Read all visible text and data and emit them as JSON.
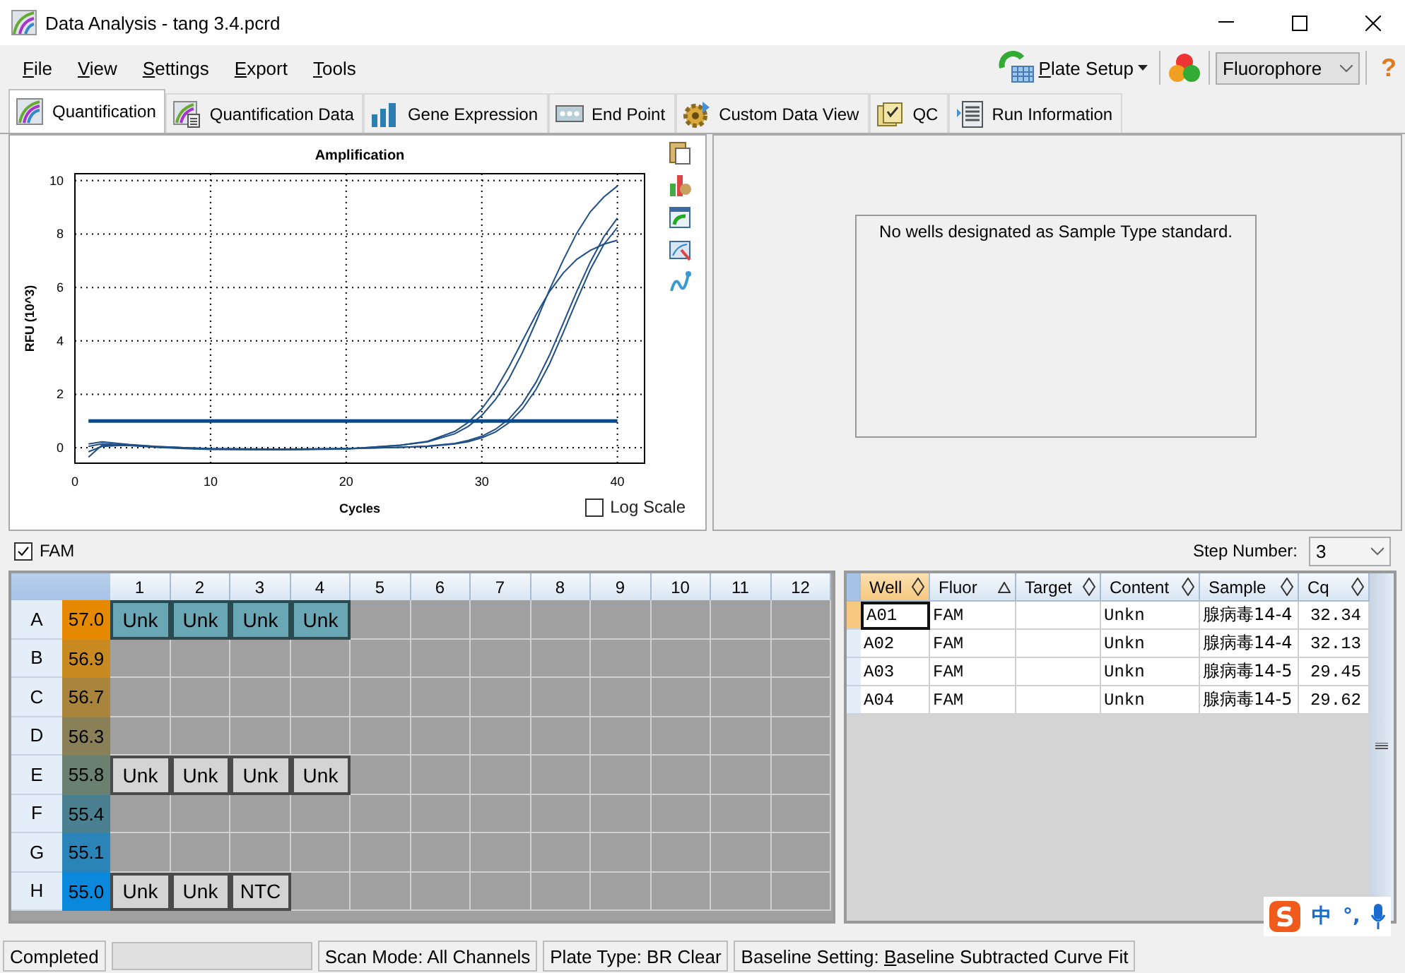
{
  "window": {
    "title": "Data Analysis - tang 3.4.pcrd"
  },
  "menu": [
    "File",
    "View",
    "Settings",
    "Export",
    "Tools"
  ],
  "toolbar": {
    "plate_setup": "Plate Setup",
    "fluorophore": "Fluorophore",
    "help": "?"
  },
  "tabs": [
    {
      "label": "Quantification",
      "selected": true
    },
    {
      "label": "Quantification Data",
      "selected": false
    },
    {
      "label": "Gene Expression",
      "selected": false
    },
    {
      "label": "End Point",
      "selected": false
    },
    {
      "label": "Custom Data View",
      "selected": false
    },
    {
      "label": "QC",
      "selected": false
    },
    {
      "label": "Run Information",
      "selected": false
    }
  ],
  "chart_panel": {
    "log_scale": {
      "label": "Log Scale",
      "checked": false
    },
    "chart_data": {
      "type": "line",
      "grid": true,
      "title": "Amplification",
      "xlabel": "Cycles",
      "ylabel": "RFU (10^3)",
      "xlim": [
        0,
        42
      ],
      "ylim": [
        -0.58,
        10.26
      ],
      "xticks": [
        0,
        10,
        20,
        30,
        40
      ],
      "yticks": [
        0,
        2,
        4,
        6,
        8,
        10
      ],
      "x": [
        1,
        2,
        4,
        6,
        8,
        10,
        15,
        20,
        24,
        26,
        28,
        29,
        30,
        31,
        32,
        33,
        34,
        35,
        36,
        37,
        38,
        39,
        40
      ],
      "series": [
        {
          "color": "#1f4f86",
          "values": [
            -0.35,
            0.1,
            0.08,
            0.02,
            -0.03,
            -0.06,
            -0.08,
            -0.05,
            0.09,
            0.22,
            0.52,
            0.8,
            1.21,
            1.8,
            2.57,
            3.56,
            4.71,
            5.92,
            7.02,
            8.03,
            8.83,
            9.39,
            9.8
          ]
        },
        {
          "color": "#1f4f86",
          "values": [
            0.05,
            0.15,
            0.1,
            0.03,
            -0.02,
            -0.05,
            -0.07,
            -0.04,
            0.09,
            0.24,
            0.61,
            0.95,
            1.46,
            2.15,
            3.02,
            4.0,
            4.98,
            5.85,
            6.54,
            7.05,
            7.39,
            7.62,
            7.77
          ]
        },
        {
          "color": "#1f4f86",
          "values": [
            0.14,
            0.22,
            0.12,
            0.05,
            0,
            -0.04,
            -0.06,
            -0.04,
            0.02,
            0.05,
            0.14,
            0.23,
            0.37,
            0.59,
            0.93,
            1.45,
            2.18,
            3.14,
            4.3,
            5.51,
            6.67,
            7.61,
            8.25
          ]
        },
        {
          "color": "#1f4f86",
          "values": [
            -0.15,
            0.05,
            0.1,
            0.04,
            0,
            -0.03,
            -0.05,
            -0.03,
            0.02,
            0.06,
            0.16,
            0.27,
            0.43,
            0.69,
            1.07,
            1.65,
            2.45,
            3.47,
            4.65,
            5.85,
            6.95,
            7.9,
            8.6
          ]
        },
        {
          "color": "#0b4a8a",
          "values": [
            1,
            1,
            1,
            1,
            1,
            1,
            1,
            1,
            1,
            1,
            1,
            1,
            1,
            1,
            1,
            1,
            1,
            1,
            1,
            1,
            1,
            1,
            1
          ]
        }
      ]
    }
  },
  "standard_curve": {
    "message": "No wells designated as Sample Type standard."
  },
  "fluor_filter": {
    "label": "FAM",
    "checked": true
  },
  "step_number": {
    "label": "Step Number:",
    "value": "3"
  },
  "plate": {
    "columns": [
      "1",
      "2",
      "3",
      "4",
      "5",
      "6",
      "7",
      "8",
      "9",
      "10",
      "11",
      "12"
    ],
    "rows": [
      {
        "label": "A",
        "temperature": "57.0",
        "color": "#e58a00",
        "wells": [
          {
            "content": "Unk",
            "selected": true
          },
          {
            "content": "Unk",
            "selected": true
          },
          {
            "content": "Unk",
            "selected": true
          },
          {
            "content": "Unk",
            "selected": true
          }
        ]
      },
      {
        "label": "B",
        "temperature": "56.9",
        "color": "#c98a22",
        "wells": []
      },
      {
        "label": "C",
        "temperature": "56.7",
        "color": "#a8843c",
        "wells": []
      },
      {
        "label": "D",
        "temperature": "56.3",
        "color": "#8a8058",
        "wells": []
      },
      {
        "label": "E",
        "temperature": "55.8",
        "color": "#6a8070",
        "wells": [
          {
            "content": "Unk",
            "selected": false
          },
          {
            "content": "Unk",
            "selected": false
          },
          {
            "content": "Unk",
            "selected": false
          },
          {
            "content": "Unk",
            "selected": false
          }
        ]
      },
      {
        "label": "F",
        "temperature": "55.4",
        "color": "#4a8090",
        "wells": []
      },
      {
        "label": "G",
        "temperature": "55.1",
        "color": "#2a84b8",
        "wells": []
      },
      {
        "label": "H",
        "temperature": "55.0",
        "color": "#0a88dc",
        "wells": [
          {
            "content": "Unk",
            "selected": false
          },
          {
            "content": "Unk",
            "selected": false
          },
          {
            "content": "NTC",
            "selected": false
          }
        ]
      }
    ]
  },
  "well_table": {
    "columns": [
      {
        "label": "Well",
        "sorted": false,
        "selected": true
      },
      {
        "label": "Fluor",
        "sorted": true,
        "selected": false
      },
      {
        "label": "Target",
        "sorted": false,
        "selected": false
      },
      {
        "label": "Content",
        "sorted": false,
        "selected": false
      },
      {
        "label": "Sample",
        "sorted": false,
        "selected": false
      },
      {
        "label": "Cq",
        "sorted": false,
        "selected": false
      }
    ],
    "rows": [
      {
        "well": "A01",
        "fluor": "FAM",
        "content": "Unkn",
        "sample": "腺病毒14-4",
        "cq": "32.34",
        "selected": true
      },
      {
        "well": "A02",
        "fluor": "FAM",
        "content": "Unkn",
        "sample": "腺病毒14-4",
        "cq": "32.13",
        "selected": false
      },
      {
        "well": "A03",
        "fluor": "FAM",
        "content": "Unkn",
        "sample": "腺病毒14-5",
        "cq": "29.45",
        "selected": false
      },
      {
        "well": "A04",
        "fluor": "FAM",
        "content": "Unkn",
        "sample": "腺病毒14-5",
        "cq": "29.62",
        "selected": false
      }
    ]
  },
  "status_bar": {
    "state": "Completed",
    "progress": {
      "level": 0
    },
    "scan_mode": "Scan Mode: All Channels",
    "plate_type": "Plate Type: BR Clear",
    "baseline_label": "Baseline Setting:",
    "baseline_value": "Baseline Subtracted Curve Fit"
  },
  "ime_bar": {
    "items": [
      "中",
      "°,"
    ]
  }
}
